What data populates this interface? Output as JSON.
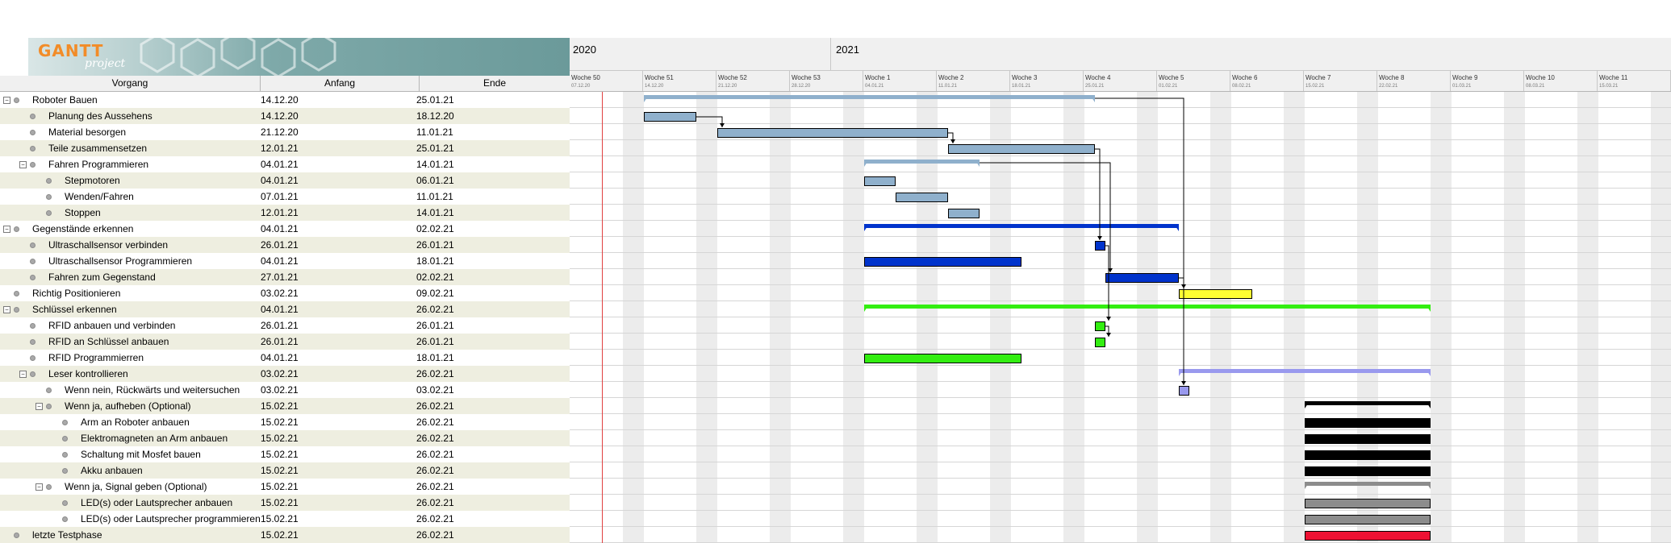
{
  "app": {
    "logo_text": "GANTT",
    "logo_subtext": "project"
  },
  "columns": {
    "task": "Vorgang",
    "start": "Anfang",
    "end": "Ende"
  },
  "timeline": {
    "years": [
      "2020",
      "2021"
    ],
    "weeks": [
      {
        "label": "Woche 50",
        "date": "07.12.20"
      },
      {
        "label": "Woche 51",
        "date": "14.12.20"
      },
      {
        "label": "Woche 52",
        "date": "21.12.20"
      },
      {
        "label": "Woche 53",
        "date": "28.12.20"
      },
      {
        "label": "Woche 1",
        "date": "04.01.21"
      },
      {
        "label": "Woche 2",
        "date": "11.01.21"
      },
      {
        "label": "Woche 3",
        "date": "18.01.21"
      },
      {
        "label": "Woche 4",
        "date": "25.01.21"
      },
      {
        "label": "Woche 5",
        "date": "01.02.21"
      },
      {
        "label": "Woche 6",
        "date": "08.02.21"
      },
      {
        "label": "Woche 7",
        "date": "15.02.21"
      },
      {
        "label": "Woche 8",
        "date": "22.02.21"
      },
      {
        "label": "Woche 9",
        "date": "01.03.21"
      },
      {
        "label": "Woche 10",
        "date": "08.03.21"
      },
      {
        "label": "Woche 11",
        "date": "15.03.21"
      }
    ]
  },
  "tasks": [
    {
      "name": "Roboter Bauen",
      "start": "14.12.20",
      "end": "25.01.21",
      "level": 0,
      "group": true,
      "color": "#8fb0cc"
    },
    {
      "name": "Planung des Aussehens",
      "start": "14.12.20",
      "end": "18.12.20",
      "level": 1,
      "group": false,
      "color": "#8fb0cc"
    },
    {
      "name": "Material besorgen",
      "start": "21.12.20",
      "end": "11.01.21",
      "level": 1,
      "group": false,
      "color": "#8fb0cc"
    },
    {
      "name": "Teile zusammensetzen",
      "start": "12.01.21",
      "end": "25.01.21",
      "level": 1,
      "group": false,
      "color": "#8fb0cc"
    },
    {
      "name": "Fahren Programmieren",
      "start": "04.01.21",
      "end": "14.01.21",
      "level": 1,
      "group": true,
      "color": "#8fb0cc"
    },
    {
      "name": "Stepmotoren",
      "start": "04.01.21",
      "end": "06.01.21",
      "level": 2,
      "group": false,
      "color": "#8fb0cc"
    },
    {
      "name": "Wenden/Fahren",
      "start": "07.01.21",
      "end": "11.01.21",
      "level": 2,
      "group": false,
      "color": "#8fb0cc"
    },
    {
      "name": "Stoppen",
      "start": "12.01.21",
      "end": "14.01.21",
      "level": 2,
      "group": false,
      "color": "#8fb0cc"
    },
    {
      "name": "Gegenstände erkennen",
      "start": "04.01.21",
      "end": "02.02.21",
      "level": 0,
      "group": true,
      "color": "#0033cc"
    },
    {
      "name": "Ultraschallsensor verbinden",
      "start": "26.01.21",
      "end": "26.01.21",
      "level": 1,
      "group": false,
      "color": "#0033cc"
    },
    {
      "name": "Ultraschallsensor Programmieren",
      "start": "04.01.21",
      "end": "18.01.21",
      "level": 1,
      "group": false,
      "color": "#0033cc"
    },
    {
      "name": "Fahren zum Gegenstand",
      "start": "27.01.21",
      "end": "02.02.21",
      "level": 1,
      "group": false,
      "color": "#0033cc"
    },
    {
      "name": "Richtig Positionieren",
      "start": "03.02.21",
      "end": "09.02.21",
      "level": 0,
      "group": false,
      "color": "#ffff33"
    },
    {
      "name": "Schlüssel erkennen",
      "start": "04.01.21",
      "end": "26.02.21",
      "level": 0,
      "group": true,
      "color": "#33ee11"
    },
    {
      "name": "RFID anbauen und verbinden",
      "start": "26.01.21",
      "end": "26.01.21",
      "level": 1,
      "group": false,
      "color": "#33ee11"
    },
    {
      "name": "RFID an Schlüssel anbauen",
      "start": "26.01.21",
      "end": "26.01.21",
      "level": 1,
      "group": false,
      "color": "#33ee11"
    },
    {
      "name": "RFID Programmierren",
      "start": "04.01.21",
      "end": "18.01.21",
      "level": 1,
      "group": false,
      "color": "#33ee11"
    },
    {
      "name": "Leser kontrollieren",
      "start": "03.02.21",
      "end": "26.02.21",
      "level": 1,
      "group": true,
      "color": "#9999ee"
    },
    {
      "name": "Wenn nein, Rückwärts und weitersuchen",
      "start": "03.02.21",
      "end": "03.02.21",
      "level": 2,
      "group": false,
      "color": "#9999ee"
    },
    {
      "name": "Wenn ja, aufheben (Optional)",
      "start": "15.02.21",
      "end": "26.02.21",
      "level": 2,
      "group": true,
      "color": "#000000"
    },
    {
      "name": "Arm an Roboter anbauen",
      "start": "15.02.21",
      "end": "26.02.21",
      "level": 3,
      "group": false,
      "color": "#000000"
    },
    {
      "name": "Elektromagneten an Arm anbauen",
      "start": "15.02.21",
      "end": "26.02.21",
      "level": 3,
      "group": false,
      "color": "#000000"
    },
    {
      "name": "Schaltung mit Mosfet bauen",
      "start": "15.02.21",
      "end": "26.02.21",
      "level": 3,
      "group": false,
      "color": "#000000"
    },
    {
      "name": "Akku anbauen",
      "start": "15.02.21",
      "end": "26.02.21",
      "level": 3,
      "group": false,
      "color": "#000000"
    },
    {
      "name": "Wenn ja, Signal geben (Optional)",
      "start": "15.02.21",
      "end": "26.02.21",
      "level": 2,
      "group": true,
      "color": "#8c8c8c"
    },
    {
      "name": "LED(s) oder Lautsprecher anbauen",
      "start": "15.02.21",
      "end": "26.02.21",
      "level": 3,
      "group": false,
      "color": "#8c8c8c"
    },
    {
      "name": "LED(s) oder Lautsprecher programmieren",
      "start": "15.02.21",
      "end": "26.02.21",
      "level": 3,
      "group": false,
      "color": "#8c8c8c"
    },
    {
      "name": "letzte Testphase",
      "start": "15.02.21",
      "end": "26.02.21",
      "level": 0,
      "group": false,
      "color": "#ee1133"
    }
  ],
  "dependencies": [
    [
      1,
      2
    ],
    [
      2,
      3
    ],
    [
      3,
      9
    ],
    [
      4,
      11
    ],
    [
      0,
      18
    ],
    [
      11,
      12
    ],
    [
      9,
      14
    ],
    [
      14,
      15
    ]
  ],
  "today_date": "10.12.20"
}
